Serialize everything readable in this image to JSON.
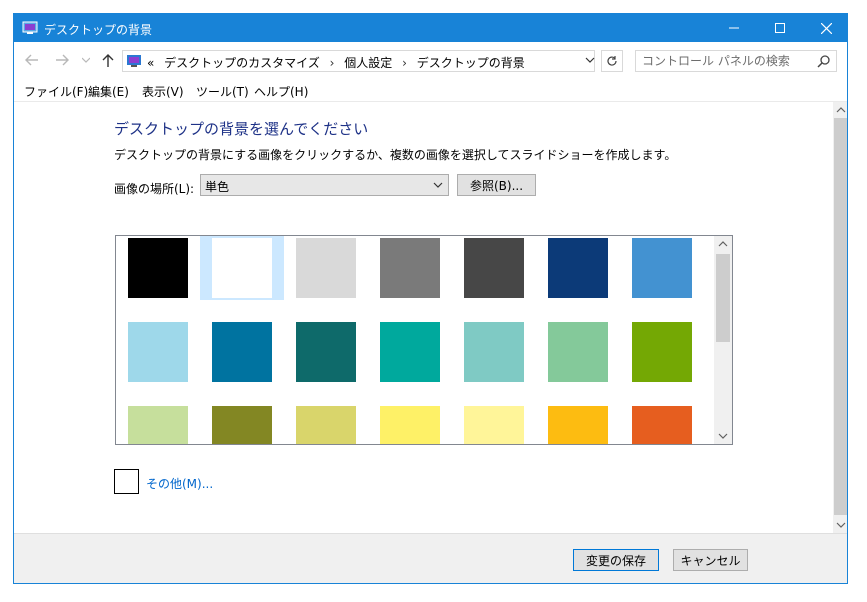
{
  "window": {
    "title": "デスクトップの背景"
  },
  "nav": {
    "breadcrumb_prefix": "«",
    "crumbs": [
      "デスクトップのカスタマイズ",
      "個人設定",
      "デスクトップの背景"
    ],
    "separator": "›",
    "search_placeholder": "コントロール パネルの検索"
  },
  "menu": [
    "ファイル(F)",
    "編集(E)",
    "表示(V)",
    "ツール(T)",
    "ヘルプ(H)"
  ],
  "main": {
    "heading": "デスクトップの背景を選んでください",
    "description": "デスクトップの背景にする画像をクリックするか、複数の画像を選択してスライドショーを作成します。",
    "location_label": "画像の場所(L):",
    "location_value": "単色",
    "browse_label": "参照(B)...",
    "other_label": "その他(M)..."
  },
  "colors": [
    "#000000",
    "#ffffff",
    "#d9d9d9",
    "#7a7a7a",
    "#474747",
    "#0c3a78",
    "#4392d1",
    "#9ed8ea",
    "#0073a0",
    "#0e6a6a",
    "#00a99d",
    "#7fcac4",
    "#84c99a",
    "#74a804",
    "#c6df9c",
    "#838723",
    "#d9d56b",
    "#fef167",
    "#fff599",
    "#fdbc11",
    "#e65e1f"
  ],
  "selected_color_index": 1,
  "footer": {
    "save_label": "変更の保存",
    "cancel_label": "キャンセル"
  },
  "accent_color": "#1883d7",
  "link_color": "#0066cc"
}
